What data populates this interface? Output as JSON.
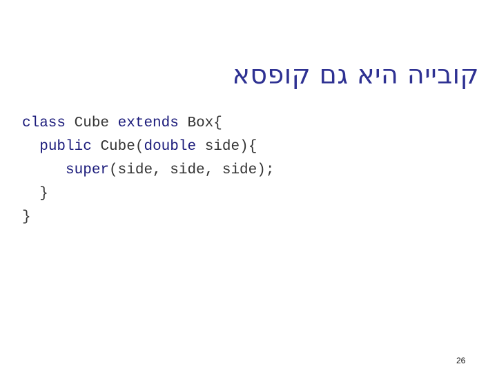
{
  "slide": {
    "title": "קובייה היא גם קופסא",
    "code_lines": [
      {
        "indent": "",
        "tokens": [
          {
            "kw": true,
            "text": "class"
          },
          {
            "kw": false,
            "text": " Cube "
          },
          {
            "kw": true,
            "text": "extends"
          },
          {
            "kw": false,
            "text": " Box{"
          }
        ]
      },
      {
        "indent": "  ",
        "tokens": [
          {
            "kw": true,
            "text": "public"
          },
          {
            "kw": false,
            "text": " Cube("
          },
          {
            "kw": true,
            "text": "double"
          },
          {
            "kw": false,
            "text": " side){"
          }
        ]
      },
      {
        "indent": "     ",
        "tokens": [
          {
            "kw": true,
            "text": "super"
          },
          {
            "kw": false,
            "text": "(side, side, side);"
          }
        ]
      },
      {
        "indent": "  ",
        "tokens": [
          {
            "kw": false,
            "text": "}"
          }
        ]
      },
      {
        "indent": "",
        "tokens": [
          {
            "kw": false,
            "text": "}"
          }
        ]
      }
    ],
    "page_number": "26"
  },
  "colors": {
    "title": "#2e3192",
    "keyword": "#1a1a7a",
    "code_text": "#333333"
  }
}
